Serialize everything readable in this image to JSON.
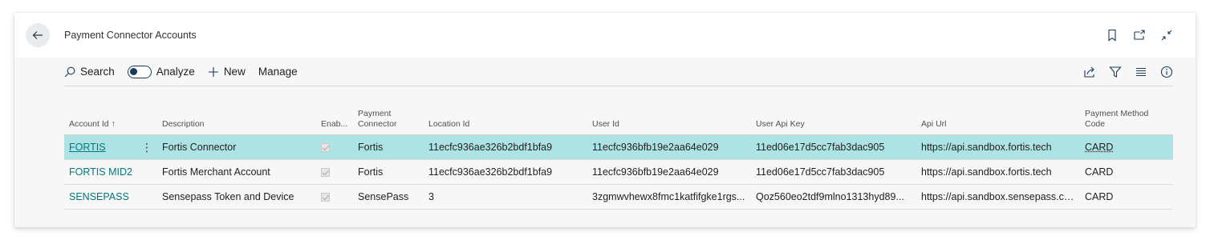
{
  "page": {
    "title": "Payment Connector Accounts"
  },
  "toolbar": {
    "search_label": "Search",
    "analyze_label": "Analyze",
    "new_label": "New",
    "manage_label": "Manage"
  },
  "columns": [
    {
      "label": "Account Id ↑"
    },
    {
      "label": "Description"
    },
    {
      "label": "Enab..."
    },
    {
      "label": "Payment Connector"
    },
    {
      "label": "Location Id"
    },
    {
      "label": "User Id"
    },
    {
      "label": "User Api Key"
    },
    {
      "label": "Api Url"
    },
    {
      "label": "Payment Method Code"
    }
  ],
  "rows": [
    {
      "account_id": "FORTIS",
      "description": "Fortis Connector",
      "enabled": true,
      "payment_connector": "Fortis",
      "location_id": "11ecfc936ae326b2bdf1bfa9",
      "user_id": "11ecfc936bfb19e2aa64e029",
      "user_api_key": "11ed06e17d5cc7fab3dac905",
      "api_url": "https://api.sandbox.fortis.tech",
      "payment_method_code": "CARD"
    },
    {
      "account_id": "FORTIS MID2",
      "description": "Fortis Merchant Account",
      "enabled": true,
      "payment_connector": "Fortis",
      "location_id": "11ecfc936ae326b2bdf1bfa9",
      "user_id": "11ecfc936bfb19e2aa64e029",
      "user_api_key": "11ed06e17d5cc7fab3dac905",
      "api_url": "https://api.sandbox.fortis.tech",
      "payment_method_code": "CARD"
    },
    {
      "account_id": "SENSEPASS",
      "description": "Sensepass Token and Device",
      "enabled": true,
      "payment_connector": "SensePass",
      "location_id": "3",
      "user_id": "3zgmwvhewx8fmc1katfifgke1rgs...",
      "user_api_key": "Qoz560eo2tdf9mlno1313hyd89...",
      "api_url": "https://api.sandbox.sensepass.co...",
      "payment_method_code": "CARD"
    }
  ],
  "colors": {
    "selected_row": "#aee3e6",
    "link": "#00797c",
    "toggle": "#1c3a5c"
  },
  "icons": {
    "back": "arrow-left-icon",
    "bookmark": "bookmark-icon",
    "open_new": "open-in-new-window-icon",
    "collapse": "collapse-icon",
    "search": "search-icon",
    "new": "plus-icon",
    "share": "share-icon",
    "filter": "filter-icon",
    "list": "list-view-icon",
    "info": "info-icon"
  }
}
